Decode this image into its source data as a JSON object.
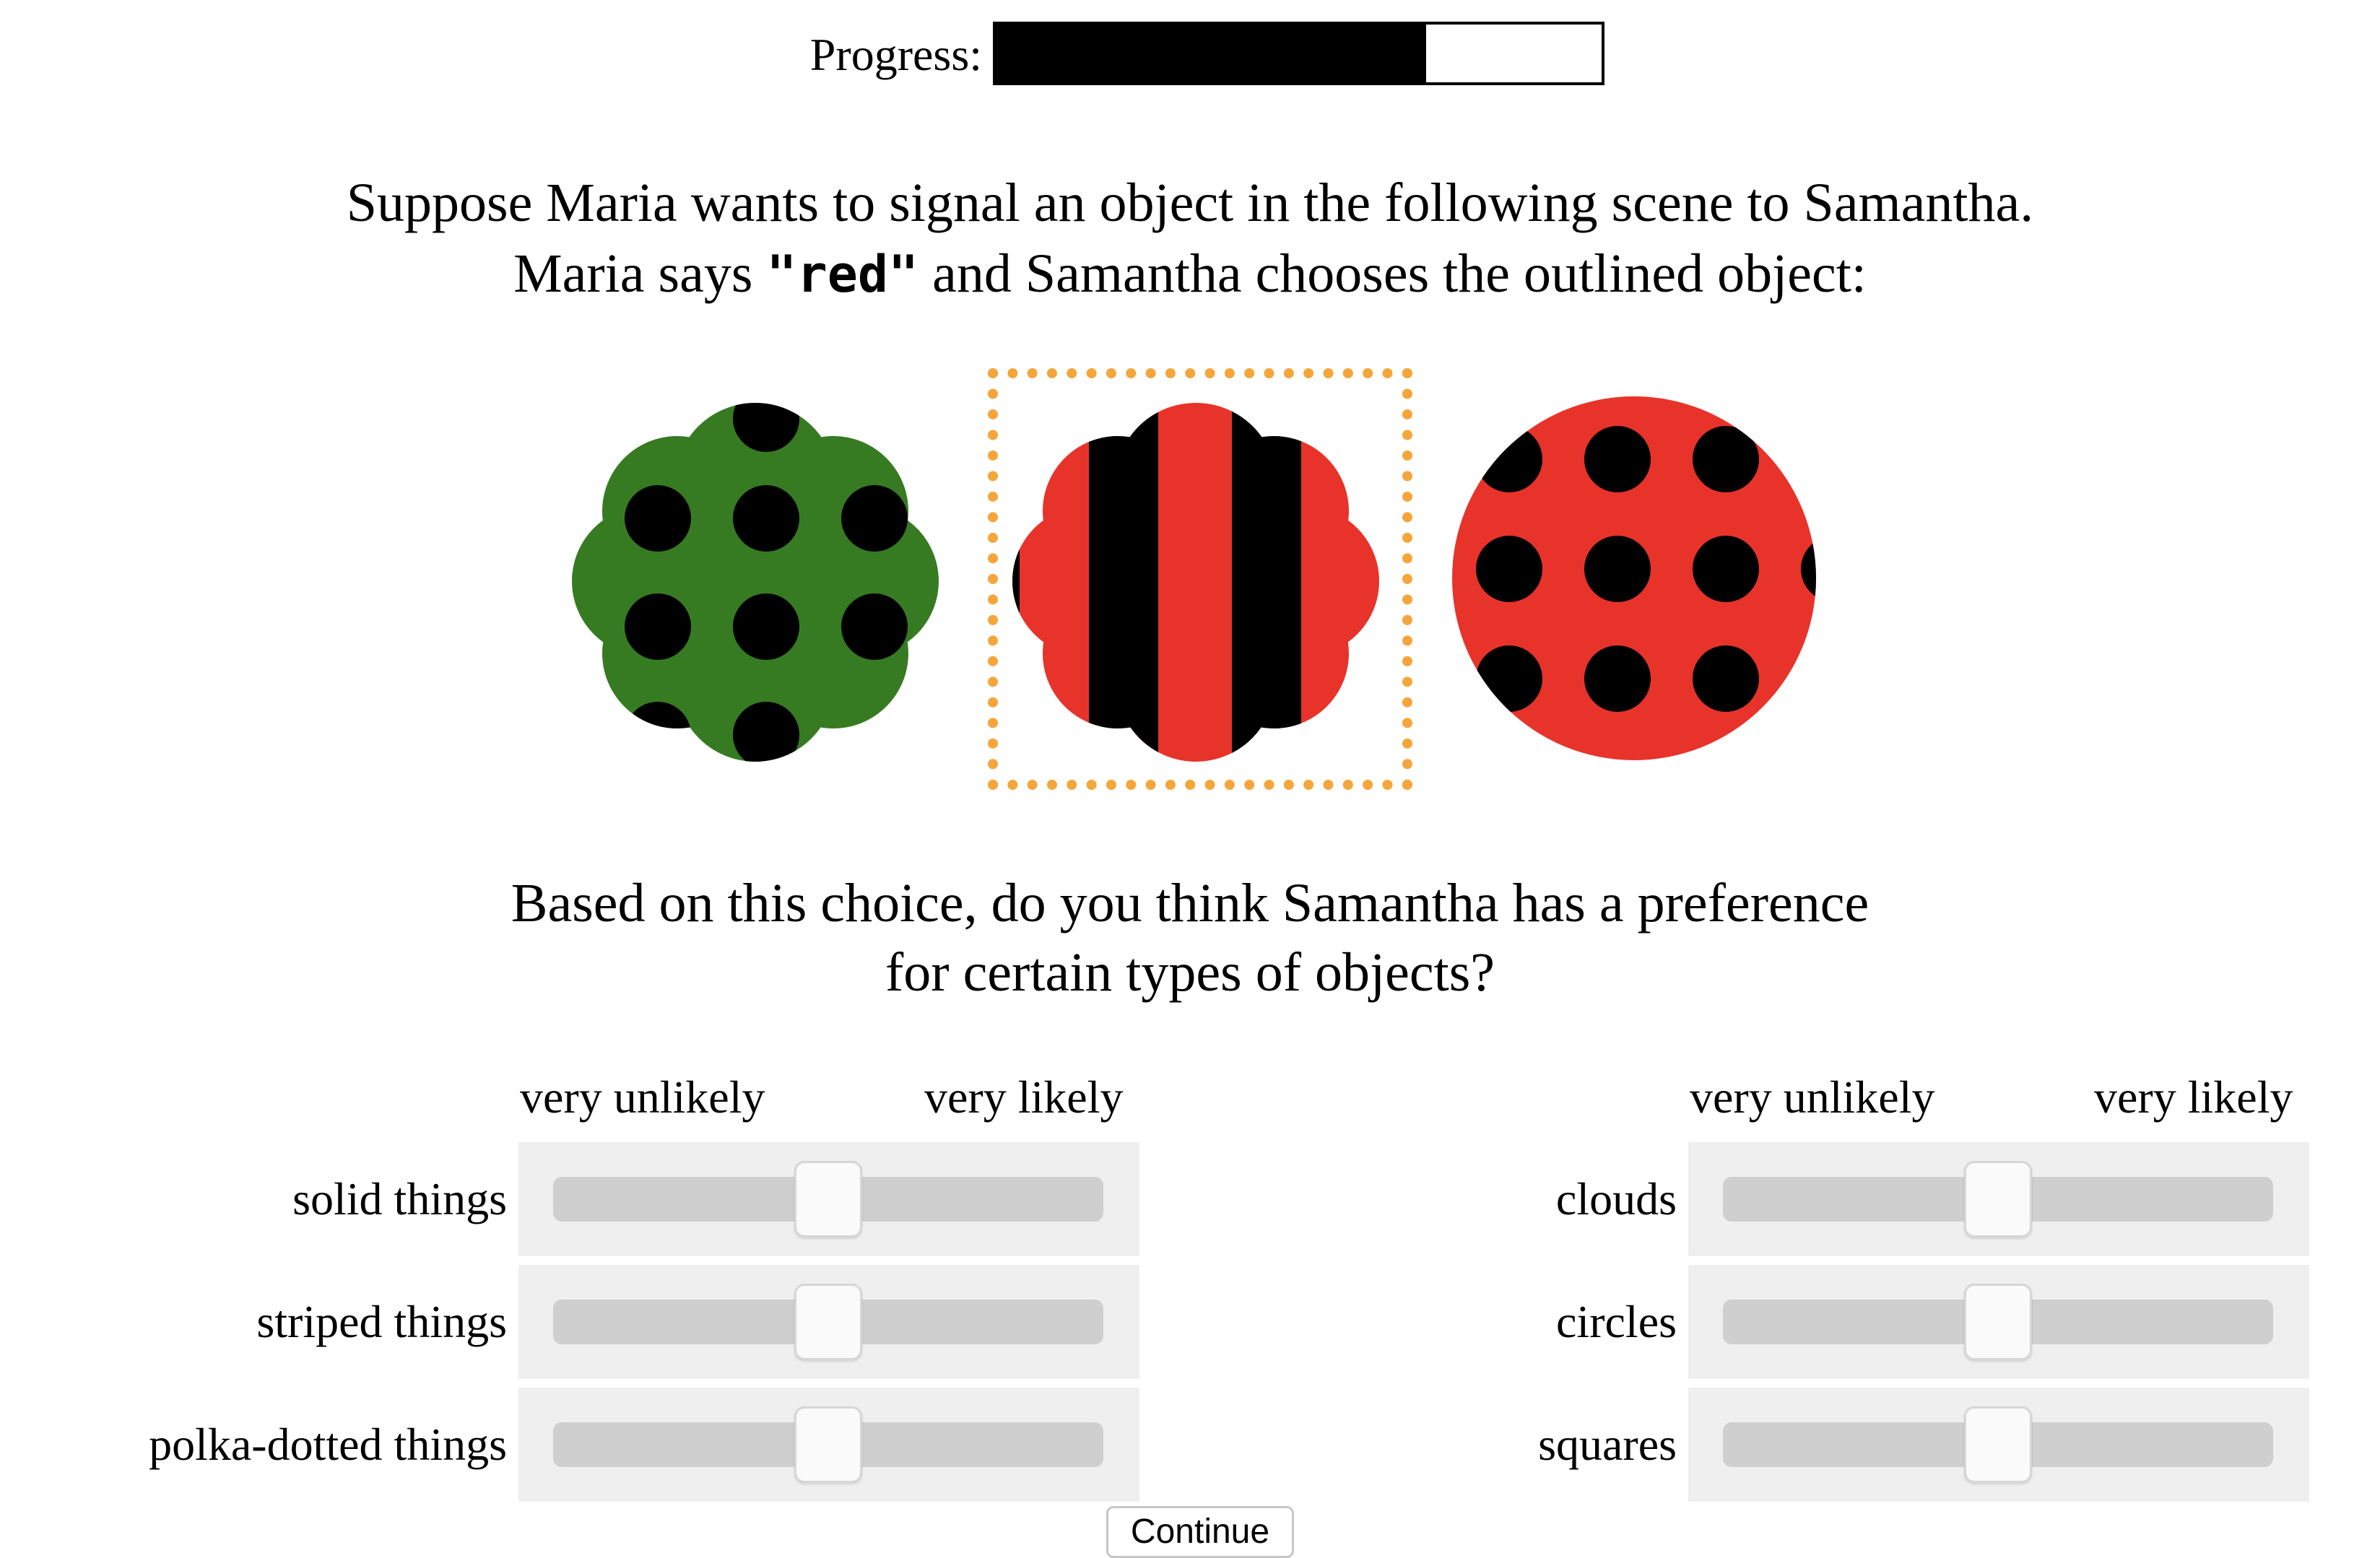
{
  "progress": {
    "label": "Progress:",
    "fraction": 0.71
  },
  "prompt": {
    "line1": "Suppose Maria wants to signal an object in the following scene to Samantha.",
    "line2_before": "Maria says ",
    "word": "\"red\"",
    "line2_after": " and Samantha chooses the outlined object:"
  },
  "scene": {
    "objects": [
      {
        "shape": "cloud",
        "color": "green",
        "pattern": "polka-dotted",
        "hex": "#367b22"
      },
      {
        "shape": "cloud",
        "color": "red",
        "pattern": "striped",
        "hex": "#e8332a",
        "outlined": true
      },
      {
        "shape": "circle",
        "color": "red",
        "pattern": "polka-dotted",
        "hex": "#e8332a"
      }
    ],
    "outline_color": "#f5a63a"
  },
  "question": {
    "line1": "Based on this choice, do you think Samantha has a preference",
    "line2": "for certain types of objects?"
  },
  "scale": {
    "low": "very unlikely",
    "high": "very likely"
  },
  "sliders_left": [
    {
      "label": "solid things",
      "value": 0.5
    },
    {
      "label": "striped things",
      "value": 0.5
    },
    {
      "label": "polka-dotted things",
      "value": 0.5
    }
  ],
  "sliders_right": [
    {
      "label": "clouds",
      "value": 0.5
    },
    {
      "label": "circles",
      "value": 0.5
    },
    {
      "label": "squares",
      "value": 0.5
    }
  ],
  "continue_label": "Continue"
}
